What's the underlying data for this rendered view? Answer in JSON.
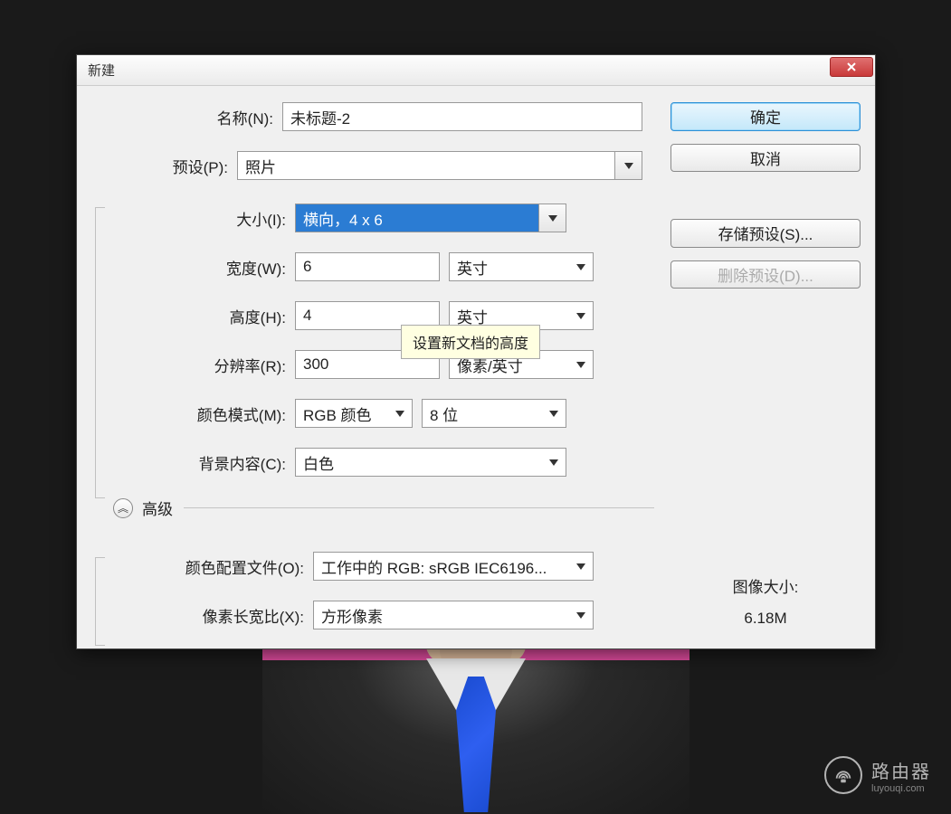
{
  "dialog": {
    "title": "新建",
    "name_label": "名称(N):",
    "name_value": "未标题-2",
    "preset_label": "预设(P):",
    "preset_value": "照片",
    "size_label": "大小(I):",
    "size_value": "横向，4 x 6",
    "width_label": "宽度(W):",
    "width_value": "6",
    "width_unit": "英寸",
    "height_label": "高度(H):",
    "height_value": "4",
    "height_unit": "英寸",
    "resolution_label": "分辨率(R):",
    "resolution_value": "300",
    "resolution_unit": "像素/英寸",
    "color_mode_label": "颜色模式(M):",
    "color_mode_value": "RGB 颜色",
    "color_depth_value": "8 位",
    "background_label": "背景内容(C):",
    "background_value": "白色",
    "advanced_label": "高级",
    "color_profile_label": "颜色配置文件(O):",
    "color_profile_value": "工作中的 RGB: sRGB IEC6196...",
    "pixel_ratio_label": "像素长宽比(X):",
    "pixel_ratio_value": "方形像素",
    "tooltip": "设置新文档的高度"
  },
  "buttons": {
    "ok": "确定",
    "cancel": "取消",
    "save_preset": "存储预设(S)...",
    "delete_preset": "删除预设(D)..."
  },
  "info": {
    "image_size_label": "图像大小:",
    "image_size_value": "6.18M"
  },
  "watermark": {
    "title": "路由器",
    "sub": "luyouqi.com"
  }
}
